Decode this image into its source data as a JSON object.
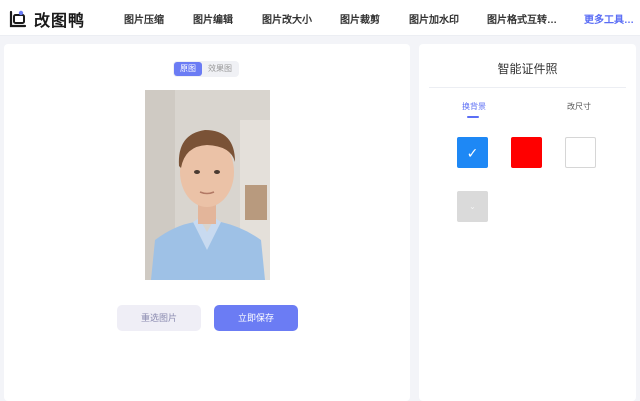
{
  "header": {
    "logo_text": "改图鸭",
    "nav": [
      {
        "label": "图片压缩"
      },
      {
        "label": "图片编辑"
      },
      {
        "label": "图片改大小"
      },
      {
        "label": "图片裁剪"
      },
      {
        "label": "图片加水印"
      },
      {
        "label": "图片格式互转…"
      }
    ],
    "more_label": "更多工具…"
  },
  "preview": {
    "toggle": {
      "original": "原图",
      "result": "效果图",
      "active": "original"
    },
    "reselect_label": "重选图片",
    "save_label": "立即保存"
  },
  "panel": {
    "title": "智能证件照",
    "tabs": [
      {
        "label": "换背景",
        "active": true
      },
      {
        "label": "改尺寸",
        "active": false
      }
    ],
    "swatches": [
      {
        "color": "#1e88f5",
        "selected": true
      },
      {
        "color": "#ff0000",
        "selected": false
      },
      {
        "color": "#ffffff",
        "selected": false
      },
      {
        "color": "#dadada",
        "selected": false,
        "icon": "chevron-down-icon"
      }
    ]
  },
  "colors": {
    "accent": "#6b7cf4",
    "accent_text": "#5b6ef5"
  }
}
